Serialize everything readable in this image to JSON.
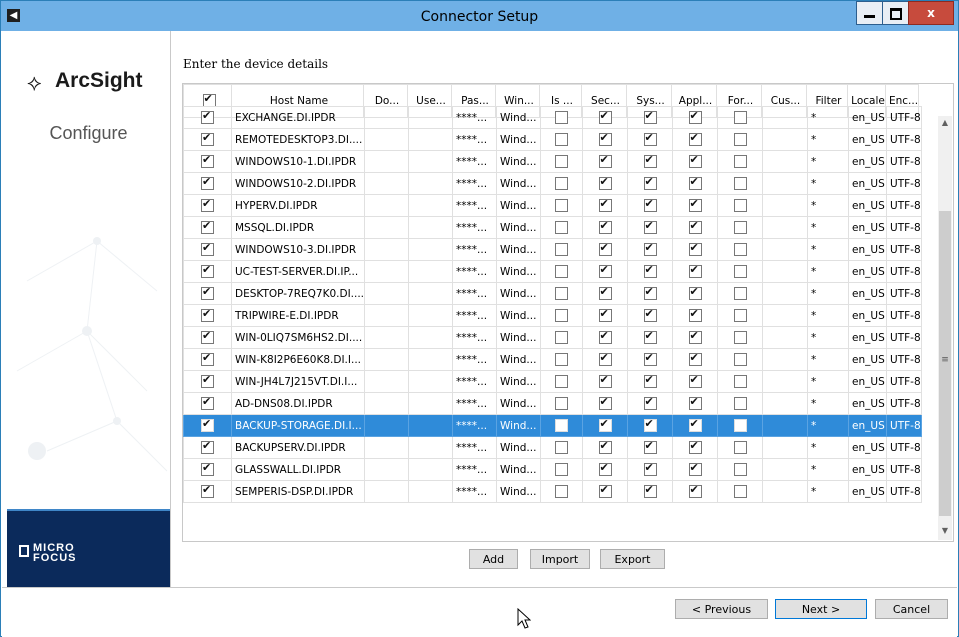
{
  "window": {
    "title": "Connector Setup",
    "app_icon": "arrow-left-icon",
    "close_label": "x"
  },
  "sidebar": {
    "brand": "ArcSight",
    "brand_icon": "arcsight-star-icon",
    "section": "Configure",
    "vendor": "MICRO FOCUS",
    "vendor_line1": "MICRO",
    "vendor_line2": "FOCUS"
  },
  "main": {
    "heading": "Enter the device details"
  },
  "table": {
    "columns": [
      "Host Name",
      "Do...",
      "Use...",
      "Pas...",
      "Win...",
      "Is ...",
      "Sec...",
      "Sys...",
      "Appl...",
      "For...",
      "Cus...",
      "Filter",
      "Locale",
      "Enc..."
    ],
    "rows": [
      {
        "host": "EXCHANGE.DI.IPDR",
        "pass": "****...",
        "win": "Wind...",
        "filter": "*",
        "locale": "en_US",
        "enc": "UTF-8"
      },
      {
        "host": "REMOTEDESKTOP3.DI....",
        "pass": "****...",
        "win": "Wind...",
        "filter": "*",
        "locale": "en_US",
        "enc": "UTF-8"
      },
      {
        "host": "WINDOWS10-1.DI.IPDR",
        "pass": "****...",
        "win": "Wind...",
        "filter": "*",
        "locale": "en_US",
        "enc": "UTF-8"
      },
      {
        "host": "WINDOWS10-2.DI.IPDR",
        "pass": "****...",
        "win": "Wind...",
        "filter": "*",
        "locale": "en_US",
        "enc": "UTF-8"
      },
      {
        "host": "HYPERV.DI.IPDR",
        "pass": "****...",
        "win": "Wind...",
        "filter": "*",
        "locale": "en_US",
        "enc": "UTF-8"
      },
      {
        "host": "MSSQL.DI.IPDR",
        "pass": "****...",
        "win": "Wind...",
        "filter": "*",
        "locale": "en_US",
        "enc": "UTF-8"
      },
      {
        "host": "WINDOWS10-3.DI.IPDR",
        "pass": "****...",
        "win": "Wind...",
        "filter": "*",
        "locale": "en_US",
        "enc": "UTF-8"
      },
      {
        "host": "UC-TEST-SERVER.DI.IP...",
        "pass": "****...",
        "win": "Wind...",
        "filter": "*",
        "locale": "en_US",
        "enc": "UTF-8"
      },
      {
        "host": "DESKTOP-7REQ7K0.DI....",
        "pass": "****...",
        "win": "Wind...",
        "filter": "*",
        "locale": "en_US",
        "enc": "UTF-8"
      },
      {
        "host": "TRIPWIRE-E.DI.IPDR",
        "pass": "****...",
        "win": "Wind...",
        "filter": "*",
        "locale": "en_US",
        "enc": "UTF-8"
      },
      {
        "host": "WIN-0LIQ7SM6HS2.DI....",
        "pass": "****...",
        "win": "Wind...",
        "filter": "*",
        "locale": "en_US",
        "enc": "UTF-8"
      },
      {
        "host": "WIN-K8I2P6E60K8.DI.I...",
        "pass": "****...",
        "win": "Wind...",
        "filter": "*",
        "locale": "en_US",
        "enc": "UTF-8"
      },
      {
        "host": "WIN-JH4L7J215VT.DI.I...",
        "pass": "****...",
        "win": "Wind...",
        "filter": "*",
        "locale": "en_US",
        "enc": "UTF-8"
      },
      {
        "host": "AD-DNS08.DI.IPDR",
        "pass": "****...",
        "win": "Wind...",
        "filter": "*",
        "locale": "en_US",
        "enc": "UTF-8"
      },
      {
        "host": "BACKUP-STORAGE.DI.I...",
        "pass": "****...",
        "win": "Wind...",
        "filter": "*",
        "locale": "en_US",
        "enc": "UTF-8",
        "selected": true
      },
      {
        "host": "BACKUPSERV.DI.IPDR",
        "pass": "****...",
        "win": "Wind...",
        "filter": "*",
        "locale": "en_US",
        "enc": "UTF-8"
      },
      {
        "host": "GLASSWALL.DI.IPDR",
        "pass": "****...",
        "win": "Wind...",
        "filter": "*",
        "locale": "en_US",
        "enc": "UTF-8"
      },
      {
        "host": "SEMPERIS-DSP.DI.IPDR",
        "pass": "****...",
        "win": "Wind...",
        "filter": "*",
        "locale": "en_US",
        "enc": "UTF-8"
      }
    ]
  },
  "scrollbar": {
    "up_icon": "chevron-up-icon",
    "down_icon": "chevron-down-icon",
    "grip": "≡"
  },
  "actions": {
    "add": "Add",
    "import": "Import",
    "export": "Export"
  },
  "nav": {
    "previous": "< Previous",
    "next": "Next >",
    "cancel": "Cancel"
  },
  "colors": {
    "titlebar": "#6fb0e6",
    "selection": "#2f8bd9",
    "vendor_band": "#0b2a5b"
  }
}
